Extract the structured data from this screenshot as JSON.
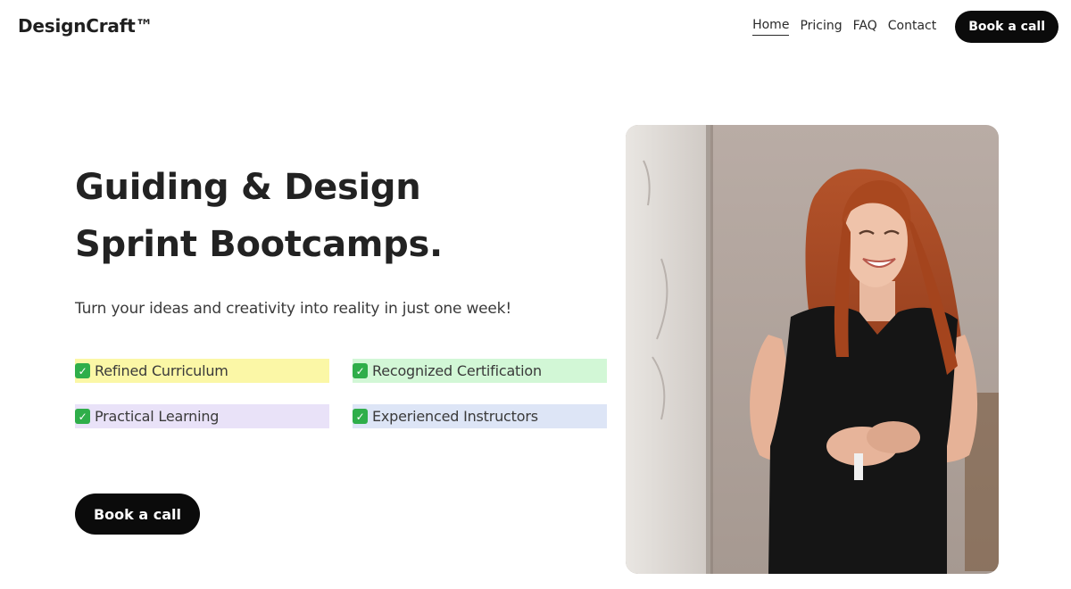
{
  "header": {
    "logo": "DesignCraft™",
    "nav": [
      "Home",
      "Pricing",
      "FAQ",
      "Contact"
    ],
    "active_nav": "Home",
    "cta_label": "Book a call"
  },
  "hero": {
    "title_line1": "Guiding & Design",
    "title_line2": "Sprint Bootcamps.",
    "subtitle": "Turn your ideas and creativity into reality in just one week!",
    "features": [
      {
        "label": "Refined Curriculum",
        "icon": "check-mark-icon",
        "highlight": "#fbf7a6"
      },
      {
        "label": "Recognized Certification",
        "icon": "check-mark-icon",
        "highlight": "#d2f7d6"
      },
      {
        "label": "Practical Learning",
        "icon": "check-mark-icon",
        "highlight": "#e9e2f8"
      },
      {
        "label": "Experienced Instructors",
        "icon": "check-mark-icon",
        "highlight": "#dde5f6"
      }
    ],
    "cta_label": "Book a call",
    "photo_icon": "hero-photo-woman-smiling"
  },
  "colors": {
    "button_bg": "#0b0b0b",
    "button_text": "#ffffff",
    "check_green": "#2fae4a"
  }
}
